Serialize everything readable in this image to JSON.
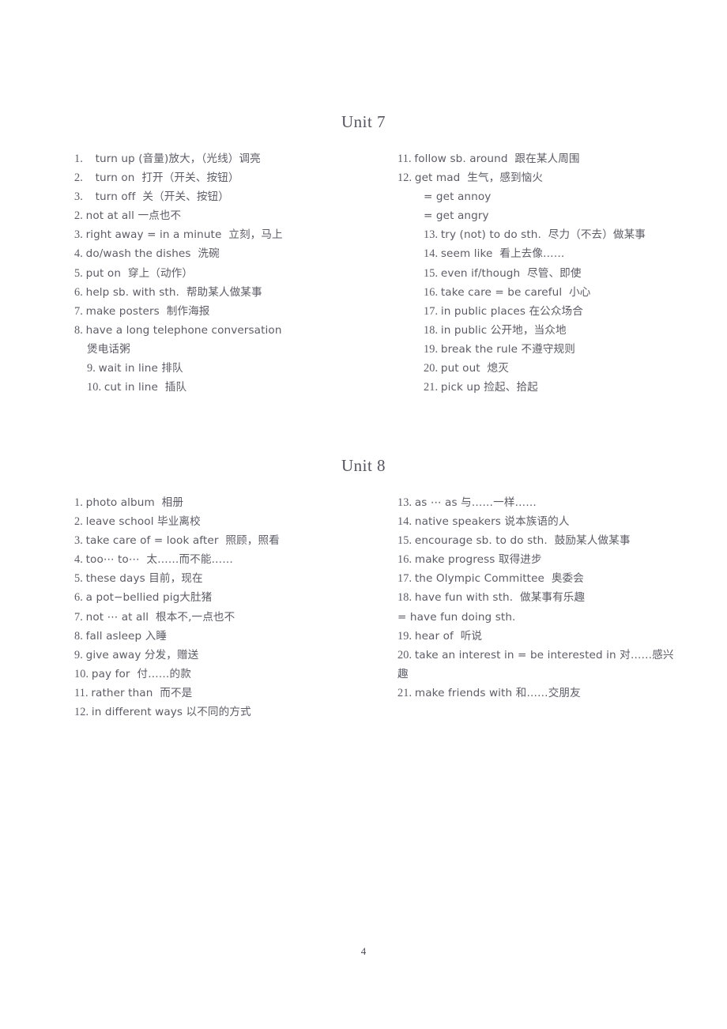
{
  "document": {
    "page_number": "4",
    "text_color": "#5c5c66",
    "background_color": "#ffffff"
  },
  "units": [
    {
      "title": "Unit 7",
      "left_column": [
        {
          "num": "1.",
          "text": "turn up (音量)放大，（光线）调亮",
          "indent": 0,
          "wide": true
        },
        {
          "num": "2.",
          "text": "turn on  打开（开关、按钮）",
          "indent": 0,
          "wide": true
        },
        {
          "num": "3.",
          "text": "turn off  关（开关、按钮）",
          "indent": 0,
          "wide": true
        },
        {
          "num": "2.",
          "text": "not at all 一点也不",
          "indent": 0,
          "wide": false
        },
        {
          "num": "3.",
          "text": "right away = in a minute  立刻，马上",
          "indent": 0,
          "wide": false
        },
        {
          "num": "4.",
          "text": "do/wash the dishes  洗碗",
          "indent": 0,
          "wide": false
        },
        {
          "num": "5.",
          "text": "put on  穿上（动作）",
          "indent": 0,
          "wide": false
        },
        {
          "num": "6.",
          "text": "help sb. with sth.  帮助某人做某事",
          "indent": 0,
          "wide": false
        },
        {
          "num": "7.",
          "text": "make posters  制作海报",
          "indent": 0,
          "wide": false
        },
        {
          "num": "8.",
          "text": "have a long telephone conversation",
          "indent": 0,
          "wide": false
        },
        {
          "num": "",
          "text": "煲电话粥",
          "indent": 1,
          "wide": false
        },
        {
          "num": "9.",
          "text": "wait in line 排队",
          "indent": 1,
          "wide": false
        },
        {
          "num": "10.",
          "text": "cut in line  插队",
          "indent": 1,
          "wide": false
        }
      ],
      "right_column": [
        {
          "num": "11.",
          "text": "follow sb. around  跟在某人周围",
          "indent": 0,
          "wide": false
        },
        {
          "num": "12.",
          "text": "get mad  生气，感到恼火",
          "indent": 0,
          "wide": false
        },
        {
          "num": "",
          "text": "= get annoy",
          "indent": 2,
          "wide": false
        },
        {
          "num": "",
          "text": "= get angry",
          "indent": 2,
          "wide": false
        },
        {
          "num": "13.",
          "text": "try (not) to do sth.  尽力（不去）做某事",
          "indent": 2,
          "wide": false
        },
        {
          "num": "14.",
          "text": "seem like  看上去像……",
          "indent": 2,
          "wide": false
        },
        {
          "num": "15.",
          "text": "even if/though  尽管、即使",
          "indent": 2,
          "wide": false
        },
        {
          "num": "16.",
          "text": "take care = be careful  小心",
          "indent": 2,
          "wide": false
        },
        {
          "num": "17.",
          "text": "in public places 在公众场合",
          "indent": 2,
          "wide": false
        },
        {
          "num": "18.",
          "text": "in public 公开地，当众地",
          "indent": 2,
          "wide": false
        },
        {
          "num": "19.",
          "text": "break the rule 不遵守规则",
          "indent": 2,
          "wide": false
        },
        {
          "num": "20.",
          "text": "put out  熄灭",
          "indent": 2,
          "wide": false
        },
        {
          "num": "21.",
          "text": "pick up 捡起、拾起",
          "indent": 2,
          "wide": false
        }
      ]
    },
    {
      "title": "Unit 8",
      "left_column": [
        {
          "num": "1.",
          "text": "photo album  相册",
          "indent": 0,
          "wide": false
        },
        {
          "num": "2.",
          "text": "leave school 毕业离校",
          "indent": 0,
          "wide": false
        },
        {
          "num": "3.",
          "text": "take care of = look after  照顾，照看",
          "indent": 0,
          "wide": false
        },
        {
          "num": "4.",
          "text": "too⋯ to⋯  太……而不能……",
          "indent": 0,
          "wide": false
        },
        {
          "num": "5.",
          "text": "these days 目前，现在",
          "indent": 0,
          "wide": false
        },
        {
          "num": "6.",
          "text": "a pot−bellied pig大肚猪",
          "indent": 0,
          "wide": false
        },
        {
          "num": "7.",
          "text": "not ⋯ at all  根本不,一点也不",
          "indent": 0,
          "wide": false
        },
        {
          "num": "8.",
          "text": "fall asleep 入睡",
          "indent": 0,
          "wide": false
        },
        {
          "num": "9.",
          "text": "give away 分发，赠送",
          "indent": 0,
          "wide": false
        },
        {
          "num": "10.",
          "text": "pay for  付……的款",
          "indent": 0,
          "wide": false
        },
        {
          "num": "11.",
          "text": "rather than  而不是",
          "indent": 0,
          "wide": false
        },
        {
          "num": "12.",
          "text": "in different ways 以不同的方式",
          "indent": 0,
          "wide": false
        }
      ],
      "right_column": [
        {
          "num": "13.",
          "text": "as ⋯ as 与……一样……",
          "indent": 0,
          "wide": false
        },
        {
          "num": "14.",
          "text": "native speakers 说本族语的人",
          "indent": 0,
          "wide": false
        },
        {
          "num": "15.",
          "text": "encourage sb. to do sth.  鼓励某人做某事",
          "indent": 0,
          "wide": false
        },
        {
          "num": "16.",
          "text": "make progress 取得进步",
          "indent": 0,
          "wide": false
        },
        {
          "num": "17.",
          "text": "the Olympic Committee  奥委会",
          "indent": 0,
          "wide": false
        },
        {
          "num": "18.",
          "text": "have fun with sth.  做某事有乐趣",
          "indent": 0,
          "wide": false
        },
        {
          "num": "",
          "text": "= have fun doing sth.",
          "indent": 0,
          "wide": false
        },
        {
          "num": "19.",
          "text": "hear of  听说",
          "indent": 0,
          "wide": false
        },
        {
          "num": "20.",
          "text": "take an interest in = be interested in 对……感兴趣",
          "indent": 0,
          "wide": false,
          "wrap": true
        },
        {
          "num": "21.",
          "text": "make friends with 和……交朋友",
          "indent": 0,
          "wide": false
        }
      ]
    }
  ]
}
